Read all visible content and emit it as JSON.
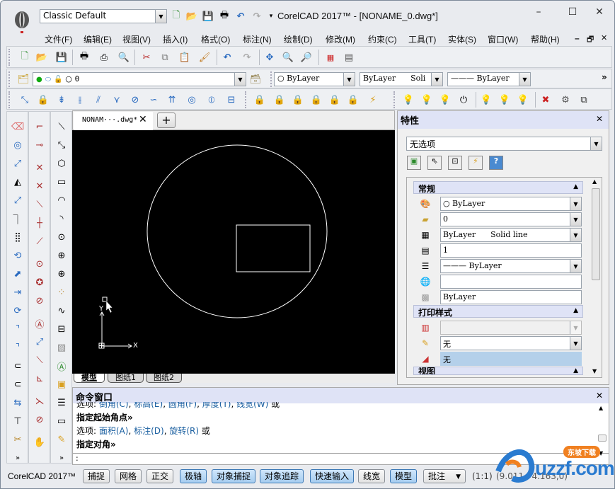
{
  "window": {
    "title": "CorelCAD 2017™ - [NONAME_0.dwg*]",
    "workspace": "Classic Default",
    "controls": {
      "minimize": "–",
      "maximize": "☐",
      "close": "✕"
    },
    "mdi_controls": {
      "minimize": "–",
      "restore": "🗗",
      "close": "✕"
    }
  },
  "quick_access": [
    "new-file-icon",
    "open-file-icon",
    "save-icon",
    "print-icon",
    "undo-icon",
    "redo-icon",
    "customize-icon"
  ],
  "menu": [
    {
      "label": "文件(F)"
    },
    {
      "label": "编辑(E)"
    },
    {
      "label": "视图(V)"
    },
    {
      "label": "插入(I)"
    },
    {
      "label": "格式(O)"
    },
    {
      "label": "标注(N)"
    },
    {
      "label": "绘制(D)"
    },
    {
      "label": "修改(M)"
    },
    {
      "label": "约束(C)"
    },
    {
      "label": "工具(T)"
    },
    {
      "label": "实体(S)"
    },
    {
      "label": "窗口(W)"
    },
    {
      "label": "帮助(H)"
    }
  ],
  "layer_toolbar": {
    "layer_value": "0",
    "color_value": "ByLayer",
    "linetype_value": "ByLayer      Soli",
    "lineweight_value": "——— ByLayer",
    "overflow": "»"
  },
  "doc_tab": {
    "label": "NONAM···.dwg*",
    "close": "✕",
    "new": "+"
  },
  "sheet_tabs": [
    {
      "label": "模型"
    },
    {
      "label": "图纸1"
    },
    {
      "label": "图纸2"
    }
  ],
  "canvas": {
    "ucs_x": "X",
    "ucs_y": "Y"
  },
  "properties": {
    "title": "特性",
    "close": "✕",
    "selection": "无选项",
    "sections": {
      "general": "常规",
      "print_style": "打印样式",
      "view": "视图"
    },
    "general_rows": [
      {
        "icon": "color-icon",
        "value": "○ ByLayer",
        "dropdown": true
      },
      {
        "icon": "layer-icon",
        "value": "0",
        "dropdown": true
      },
      {
        "icon": "linetype-icon",
        "value": "ByLayer      Solid line",
        "dropdown": true
      },
      {
        "icon": "linetype-scale-icon",
        "value": "1",
        "dropdown": false
      },
      {
        "icon": "lineweight-icon",
        "value": "——— ByLayer",
        "dropdown": true
      },
      {
        "icon": "hyperlink-icon",
        "value": "",
        "dropdown": false
      },
      {
        "icon": "transparency-icon",
        "value": "ByLayer",
        "dropdown": false
      }
    ],
    "print_rows": [
      {
        "icon": "print-style-icon",
        "value": "",
        "dropdown": true,
        "disabled": true
      },
      {
        "icon": "print-style-table-icon",
        "value": "无",
        "dropdown": true
      },
      {
        "icon": "print-table-type-icon",
        "value": "无",
        "dropdown": false,
        "highlight": true
      }
    ]
  },
  "command_window": {
    "title": "命令窗口",
    "close": "✕",
    "lines": [
      {
        "prefix": "选项: ",
        "options": [
          "倒角(C)",
          "标高(E)",
          "圆角(F)",
          "厚度(T)",
          "线宽(W)"
        ],
        "suffix": " 或"
      },
      {
        "bold": "指定起始角点»"
      },
      {
        "prefix": "选项: ",
        "options": [
          "面积(A)",
          "标注(D)",
          "旋转(R)"
        ],
        "suffix": " 或"
      },
      {
        "bold": "指定对角»"
      }
    ],
    "prompt": ":"
  },
  "status_bar": {
    "app_name": "CorelCAD 2017™",
    "buttons": [
      {
        "label": "捕捉",
        "on": false
      },
      {
        "label": "网格",
        "on": false
      },
      {
        "label": "正交",
        "on": false
      },
      {
        "label": "极轴",
        "on": true
      },
      {
        "label": "对象捕捉",
        "on": true
      },
      {
        "label": "对象追踪",
        "on": true
      },
      {
        "label": "快速输入",
        "on": true
      },
      {
        "label": "线宽",
        "on": false
      },
      {
        "label": "模型",
        "on": true
      }
    ],
    "annotation": "批注",
    "scale": "(1:1)",
    "coords": "(9.011,74.163,0)"
  },
  "watermark": {
    "text": "uzzf.com",
    "badge": "东坡下载"
  }
}
